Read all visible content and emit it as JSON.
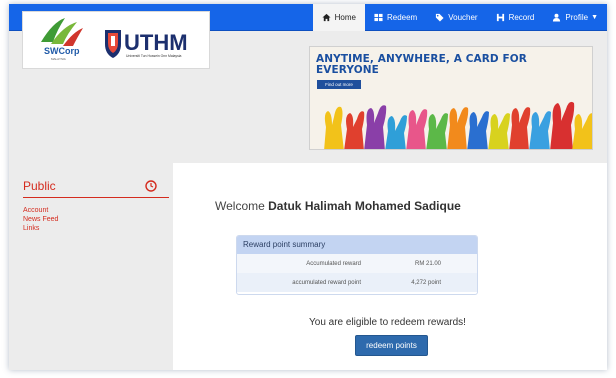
{
  "nav": {
    "items": [
      {
        "label": "Home",
        "icon": "home-icon",
        "active": true
      },
      {
        "label": "Redeem",
        "icon": "grid-icon",
        "active": false
      },
      {
        "label": "Voucher",
        "icon": "tag-icon",
        "active": false
      },
      {
        "label": "Record",
        "icon": "bookmark-icon",
        "active": false
      },
      {
        "label": "Profile",
        "icon": "user-icon",
        "active": false
      }
    ],
    "colors": {
      "bar": "#1565e8",
      "active_bg": "#f4f4f4"
    }
  },
  "logos": {
    "swcorp_text": "SWCorp",
    "swcorp_sub": "MALAYSIA",
    "uthm_text": "UTHM",
    "uthm_sub": "Universiti Tun Hussein Onn Malaysia"
  },
  "banner": {
    "title": "ANYTIME, ANYWHERE, A CARD FOR EVERYONE",
    "button_label": "Find out more"
  },
  "sidebar": {
    "title": "Public",
    "accent_color": "#d42b1e",
    "links": [
      {
        "label": "Account"
      },
      {
        "label": "News Feed"
      },
      {
        "label": "Links"
      }
    ]
  },
  "main": {
    "welcome_prefix": "Welcome",
    "user_name": "Datuk Halimah Mohamed Sadique",
    "reward": {
      "header": "Reward point summary",
      "rows": [
        {
          "label": "Accumulated reward",
          "value": "RM 21.00"
        },
        {
          "label": "accumulated reward point",
          "value": "4,272 point"
        }
      ]
    },
    "eligible_text": "You are eligible to redeem rewards!",
    "redeem_button": "redeem points"
  }
}
